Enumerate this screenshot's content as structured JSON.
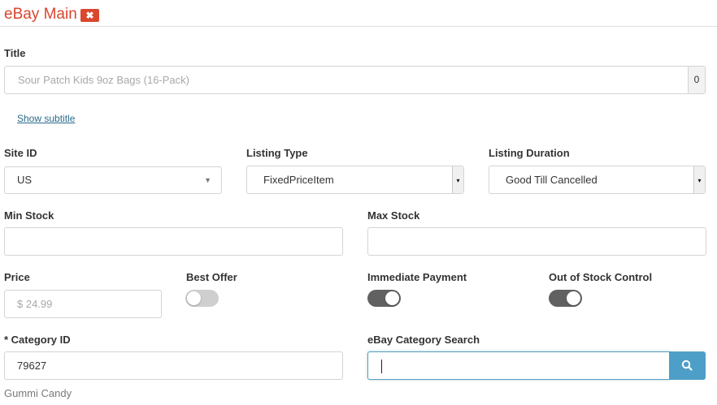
{
  "header": {
    "title": "eBay Main",
    "close_icon": "✖"
  },
  "title_field": {
    "label": "Title",
    "placeholder": "Sour Patch Kids 9oz Bags (16-Pack)",
    "char_count": "0"
  },
  "show_subtitle_link": "Show subtitle",
  "site_id": {
    "label": "Site ID",
    "value": "US"
  },
  "listing_type": {
    "label": "Listing Type",
    "value": "FixedPriceItem"
  },
  "listing_duration": {
    "label": "Listing Duration",
    "value": "Good Till Cancelled"
  },
  "min_stock": {
    "label": "Min Stock",
    "value": ""
  },
  "max_stock": {
    "label": "Max Stock",
    "value": ""
  },
  "price": {
    "label": "Price",
    "placeholder": "$ 24.99"
  },
  "best_offer": {
    "label": "Best Offer",
    "enabled": false
  },
  "immediate_payment": {
    "label": "Immediate Payment",
    "enabled": true
  },
  "out_of_stock_control": {
    "label": "Out of Stock Control",
    "enabled": true
  },
  "category_id": {
    "label": "* Category ID",
    "value": "79627",
    "category_name": "Gummi Candy"
  },
  "category_search": {
    "label": "eBay Category Search",
    "value": ""
  },
  "colors": {
    "accent_red": "#d9462f",
    "search_blue": "#4e9fc7",
    "toggle_on": "#616161",
    "toggle_off": "#cfcfcf"
  }
}
